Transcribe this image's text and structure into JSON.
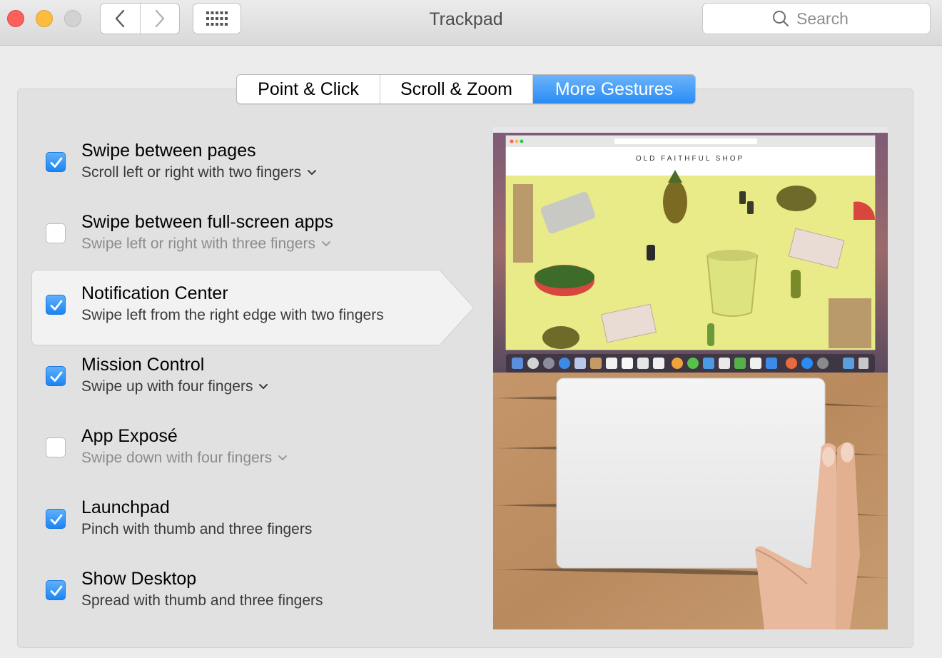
{
  "window": {
    "title": "Trackpad"
  },
  "toolbar": {
    "back_icon": "chevron-left-icon",
    "forward_icon": "chevron-right-icon",
    "grid_icon": "show-all-grid-icon"
  },
  "search": {
    "placeholder": "Search",
    "value": ""
  },
  "tabs": [
    {
      "label": "Point & Click",
      "active": false
    },
    {
      "label": "Scroll & Zoom",
      "active": false
    },
    {
      "label": "More Gestures",
      "active": true
    }
  ],
  "gestures": [
    {
      "title": "Swipe between pages",
      "detail": "Scroll left or right with two fingers",
      "checked": true,
      "has_menu": true
    },
    {
      "title": "Swipe between full-screen apps",
      "detail": "Swipe left or right with three fingers",
      "checked": false,
      "has_menu": true
    },
    {
      "title": "Notification Center",
      "detail": "Swipe left from the right edge with two fingers",
      "checked": true,
      "has_menu": false,
      "selected": true
    },
    {
      "title": "Mission Control",
      "detail": "Swipe up with four fingers",
      "checked": true,
      "has_menu": true
    },
    {
      "title": "App Exposé",
      "detail": "Swipe down with four fingers",
      "checked": false,
      "has_menu": true
    },
    {
      "title": "Launchpad",
      "detail": "Pinch with thumb and three fingers",
      "checked": true,
      "has_menu": false
    },
    {
      "title": "Show Desktop",
      "detail": "Spread with thumb and three fingers",
      "checked": true,
      "has_menu": false
    }
  ],
  "preview": {
    "site_name": "OLD FAITHFUL SHOP"
  },
  "colors": {
    "accent": "#2a8cf5",
    "checkbox_on": "#1c85f3",
    "window_bg": "#ececec",
    "panel_bg": "#e1e1e1"
  }
}
